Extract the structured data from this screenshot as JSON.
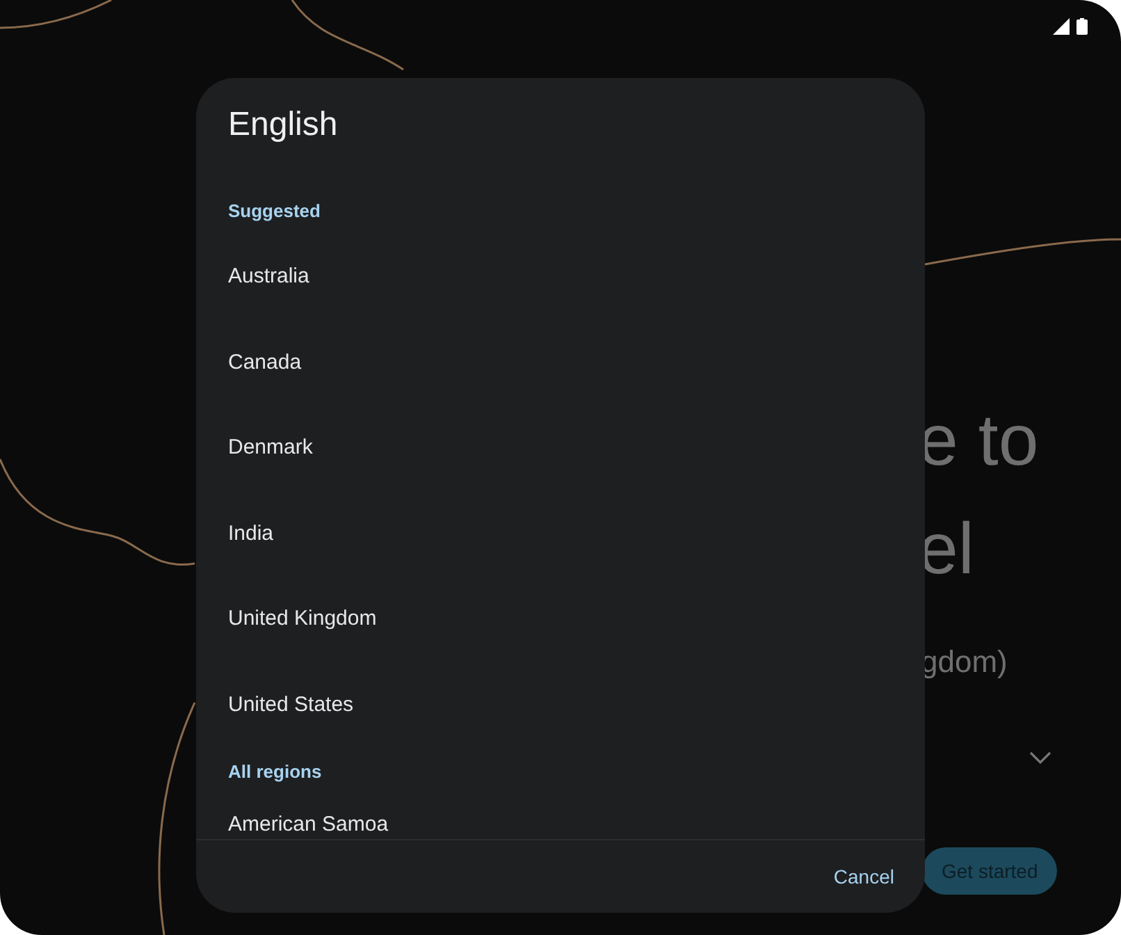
{
  "background": {
    "title_lines": [
      "e to",
      "el"
    ],
    "subtitle": "gdom)",
    "button": "Get started"
  },
  "dialog": {
    "title": "English",
    "sections": [
      {
        "heading": "Suggested",
        "items": [
          "Australia",
          "Canada",
          "Denmark",
          "India",
          "United Kingdom",
          "United States"
        ]
      },
      {
        "heading": "All regions",
        "items": [
          "American Samoa"
        ]
      }
    ],
    "cancel": "Cancel"
  }
}
